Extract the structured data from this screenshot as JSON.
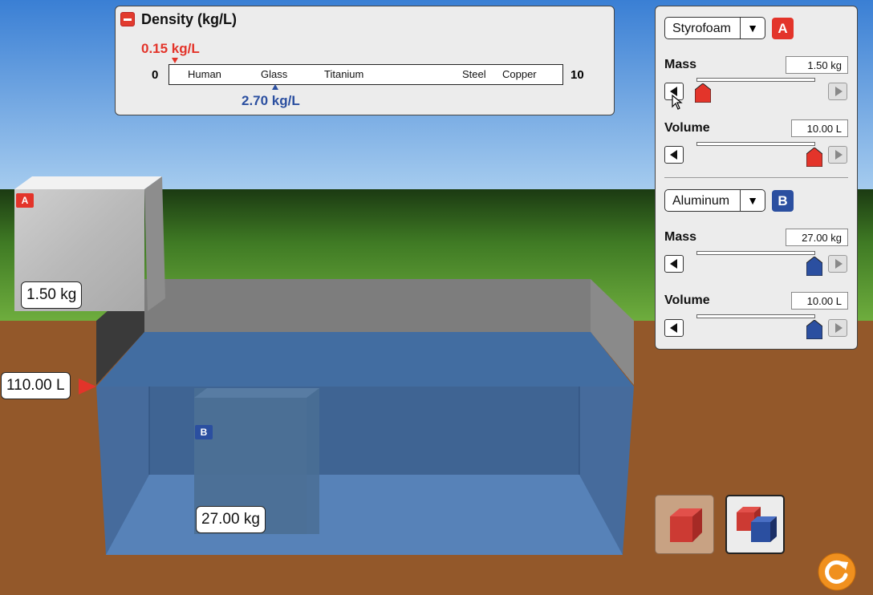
{
  "density_panel": {
    "title": "Density (kg/L)",
    "scale_min": "0",
    "scale_max": "10",
    "materials": [
      "Human",
      "Glass",
      "Titanium",
      "Steel",
      "Copper"
    ],
    "readout_a": "0.15 kg/L",
    "readout_b": "2.70 kg/L"
  },
  "block_a": {
    "material": "Styrofoam",
    "badge": "A",
    "mass_label": "Mass",
    "mass_value": "1.50 kg",
    "volume_label": "Volume",
    "volume_value": "10.00 L",
    "mass_slider_fraction": 0.0,
    "volume_slider_fraction": 1.0,
    "color": "#e3342a"
  },
  "block_b": {
    "material": "Aluminum",
    "badge": "B",
    "mass_label": "Mass",
    "mass_value": "27.00 kg",
    "volume_label": "Volume",
    "volume_value": "10.00 L",
    "mass_slider_fraction": 1.0,
    "volume_slider_fraction": 1.0,
    "color": "#2b4fa0"
  },
  "scene": {
    "block_a_mass": "1.50 kg",
    "block_b_mass": "27.00 kg",
    "water_level": "110.00 L",
    "block_a_badge": "A",
    "block_b_badge": "B"
  },
  "icons": {
    "dropdown": "triangle-down",
    "step_left": "triangle-left",
    "step_right": "triangle-right",
    "reset": "circular-arrow",
    "collapse": "minus"
  }
}
